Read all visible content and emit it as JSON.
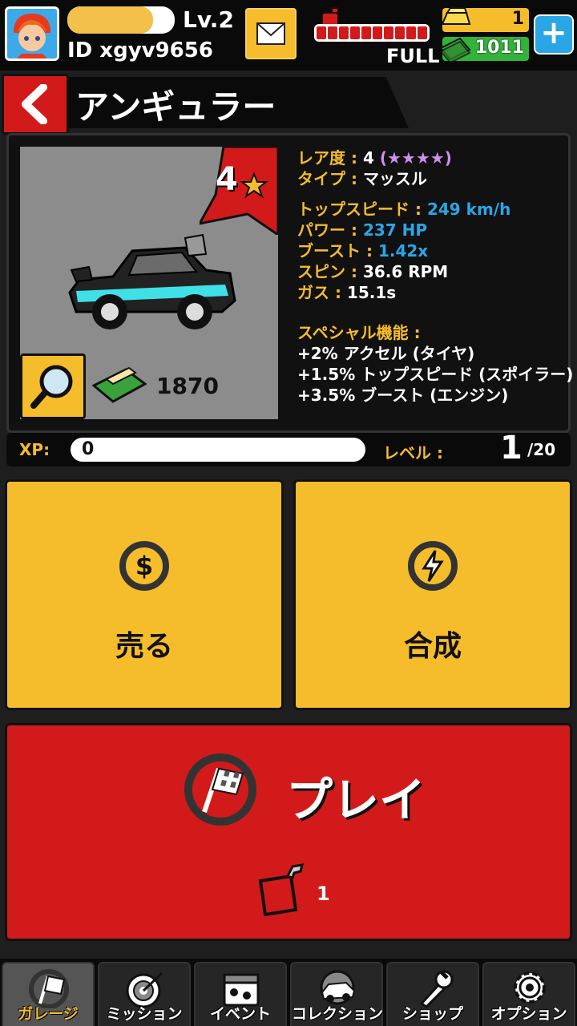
{
  "header": {
    "level": "Lv.2",
    "user_id": "ID  xgyv9656",
    "xp_progress": 0.8,
    "fuel_status": "FULL",
    "fuel_segments": 10,
    "gold": "1",
    "cash": "1011"
  },
  "title": "アンギュラー",
  "car": {
    "rarity_num": "4",
    "price": "1870",
    "stats": {
      "rarity_label": "レア度 :",
      "rarity_value": "4",
      "rarity_stars": "(★★★★)",
      "type_label": "タイプ :",
      "type_value": "マッスル",
      "speed_label": "トップスピード :",
      "speed_value": "249 km/h",
      "power_label": "パワー :",
      "power_value": "237 HP",
      "boost_label": "ブースト :",
      "boost_value": "1.42x",
      "spin_label": "スピン :",
      "spin_value": "36.6 RPM",
      "gas_label": "ガス :",
      "gas_value": "15.1s",
      "special_label": "スペシャル機能 :",
      "special_1": "+2% アクセル (タイヤ)",
      "special_2": "+1.5% トップスピード (スポイラー)",
      "special_3": "+3.5% ブースト (エンジン)"
    }
  },
  "xp": {
    "label": "XP:",
    "value": "0",
    "level_label": "レベル :",
    "level_current": "1",
    "level_max": "/20"
  },
  "actions": {
    "sell": "売る",
    "combine": "合成",
    "play": "プレイ",
    "fuel_cost": "1"
  },
  "nav": {
    "garage": "ガレージ",
    "mission": "ミッション",
    "event": "イベント",
    "collection": "コレクション",
    "shop": "ショップ",
    "option": "オプション"
  },
  "colors": {
    "yellow": "#f5bd2b",
    "red": "#d21a1a",
    "blue": "#2aa6e6",
    "green": "#32b33a",
    "purple": "#cf8ef0"
  }
}
